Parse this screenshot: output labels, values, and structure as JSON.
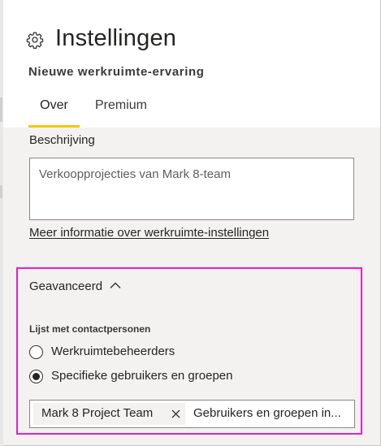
{
  "panel": {
    "title": "Instellingen",
    "subtitle": "Nieuwe werkruimte-ervaring",
    "title_icon": "gear-icon"
  },
  "tabs": [
    {
      "label": "Over",
      "selected": true
    },
    {
      "label": "Premium",
      "selected": false
    }
  ],
  "description": {
    "label": "Beschrijving",
    "value": "Verkoopprojecties van Mark 8-team"
  },
  "more_info_link": "Meer informatie over werkruimte-instellingen",
  "advanced": {
    "label": "Geavanceerd",
    "expanded": true,
    "toggle_icon": "chevron-up-icon",
    "contacts_label": "Lijst met contactpersonen",
    "options": [
      {
        "label": "Werkruimtebeheerders",
        "selected": false
      },
      {
        "label": "Specifieke gebruikers en groepen",
        "selected": true
      }
    ],
    "picker": {
      "chips": [
        {
          "label": "Mark 8 Project Team"
        }
      ],
      "remove_icon": "close-icon",
      "input_value": "Gebruikers en groepen in..."
    }
  },
  "colors": {
    "tab_underline": "#f2c811",
    "highlight_border": "#e91ec8",
    "content_background": "#f3f2f1"
  }
}
